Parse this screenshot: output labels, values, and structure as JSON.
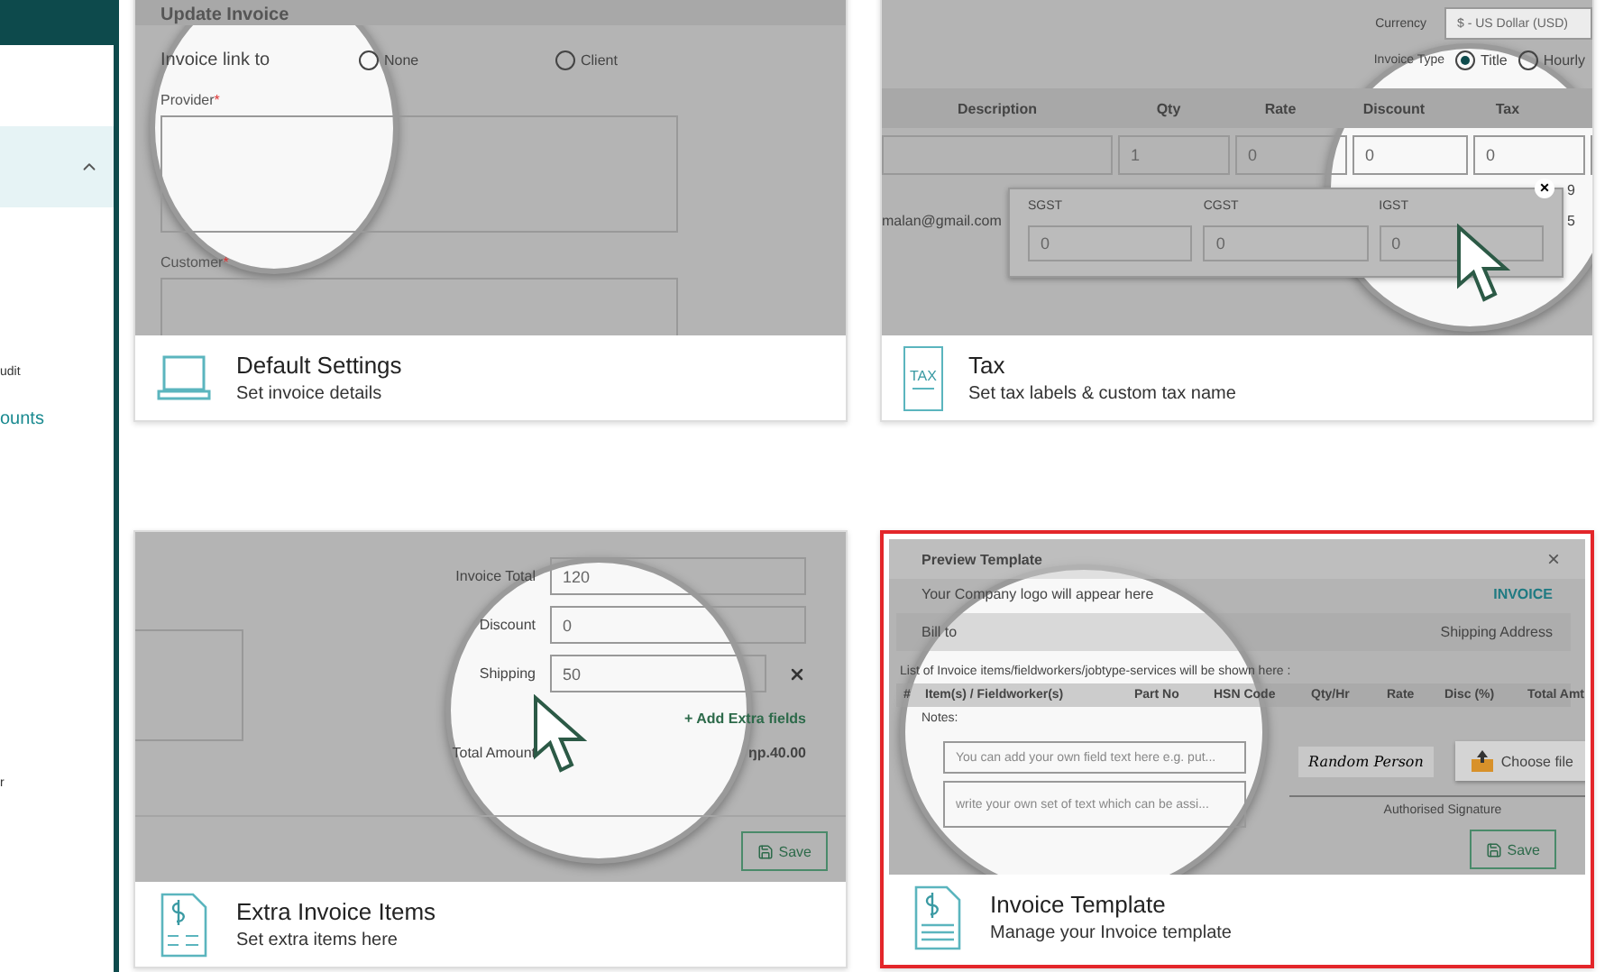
{
  "sidebar": {
    "section_expanded": true,
    "items": [
      {
        "label": "udit",
        "selected": false
      },
      {
        "label": "ounts",
        "selected": true
      },
      {
        "label": "r",
        "selected": false
      }
    ]
  },
  "cards": [
    {
      "kind": "default_settings",
      "title": "Default Settings",
      "subtitle": "Set invoice details",
      "selected": false,
      "preview": {
        "heading": "Update Invoice",
        "link_label": "Invoice link to",
        "link_options": [
          {
            "label": "None",
            "selected": false
          },
          {
            "label": "Client",
            "selected": false
          }
        ],
        "fields": [
          {
            "label": "Provider",
            "required_mark": "*"
          },
          {
            "label": "Customer",
            "required_mark": "*"
          }
        ]
      }
    },
    {
      "kind": "tax",
      "icon_text": "TAX",
      "title": "Tax",
      "subtitle": "Set tax labels & custom tax name",
      "selected": false,
      "preview": {
        "currency_label": "Currency",
        "currency_value": "$ - US Dollar (USD)",
        "type_label": "Invoice Type",
        "type_options": [
          {
            "label": "Title",
            "selected": true
          },
          {
            "label": "Hourly",
            "selected": false
          }
        ],
        "columns": [
          "Description",
          "Qty",
          "Rate",
          "Discount",
          "Tax"
        ],
        "row_values": [
          "1",
          "0",
          "0",
          "0"
        ],
        "email": "malan@gmail.com",
        "side_values": [
          "9",
          "5"
        ],
        "popup": {
          "close": "×",
          "taxes": [
            {
              "label": "SGST",
              "value": "0"
            },
            {
              "label": "CGST",
              "value": "0"
            },
            {
              "label": "IGST",
              "value": "0"
            }
          ]
        }
      }
    },
    {
      "kind": "extra_items",
      "title": "Extra Invoice Items",
      "subtitle": "Set extra items here",
      "selected": false,
      "preview": {
        "rows": [
          {
            "label": "Invoice Total",
            "value": "120",
            "removable": false
          },
          {
            "label": "Discount",
            "value": "0",
            "removable": false
          },
          {
            "label": "Shipping",
            "value": "50",
            "removable": true
          }
        ],
        "add_link": "+ Add Extra fields",
        "total_label": "Total Amount",
        "total_value": "ŋp.40.00",
        "save": "Save"
      }
    },
    {
      "kind": "template",
      "title": "Invoice Template",
      "subtitle": "Manage your Invoice template",
      "selected": true,
      "preview": {
        "title": "Preview Template",
        "close": "×",
        "logo_note": "Your Company logo will appear here",
        "invoice_label": "INVOICE",
        "bill_to": "Bill to",
        "shipping": "Shipping Address",
        "list_note": "List of Invoice items/fieldworkers/jobtype-services will be shown here :",
        "columns": [
          "#",
          "Item(s) / Fieldworker(s)",
          "Part No",
          "HSN Code",
          "Qty/Hr",
          "Rate",
          "Disc (%)",
          "Total Amt"
        ],
        "notes_label": "Notes:",
        "placeholders": [
          "You can add your own field text here e.g. put...",
          "write your own set of text which can be assi..."
        ],
        "signature": "Random Person",
        "choose_file": "Choose file",
        "signature_label": "Authorised Signature",
        "save": "Save"
      }
    }
  ]
}
